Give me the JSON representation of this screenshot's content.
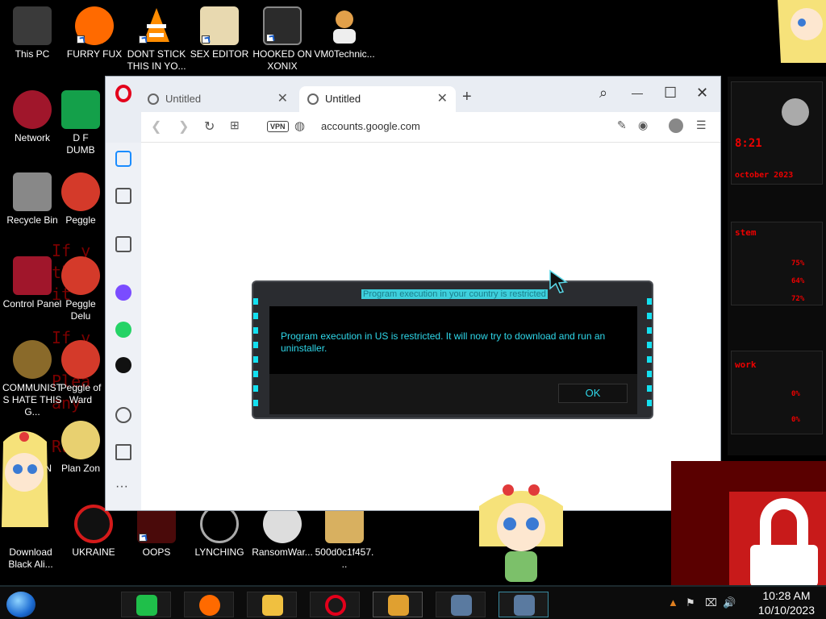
{
  "desktop": {
    "icons_top": [
      {
        "label": "This PC",
        "color": "#3a3a3a"
      },
      {
        "label": "FURRY FUX",
        "color": "#ff6a00"
      },
      {
        "label": "DONT STICK THIS IN YO...",
        "color": "#ff8c00"
      },
      {
        "label": "SEX EDITOR",
        "color": "#c8a24a"
      },
      {
        "label": "HOOKED ON XONIX",
        "color": "#2b2b2b"
      },
      {
        "label": "VM0Technic...",
        "color": "#e2a04a"
      }
    ],
    "icons_left": [
      {
        "label": "Network",
        "color": "#a0162b"
      },
      {
        "label": "Recycle Bin",
        "color": "#888888"
      },
      {
        "label": "Control Panel",
        "color": "#a0162b"
      },
      {
        "label": "COMMUNISTS HATE THIS G...",
        "color": "#8a6a2a"
      }
    ],
    "icons_col2": [
      {
        "label": "D F DUMB",
        "color": "#14a04a"
      },
      {
        "label": "Peggle",
        "color": "#d43a2a"
      },
      {
        "label": "Peggle Delu",
        "color": "#d43a2a"
      },
      {
        "label": "Peggle of Ward",
        "color": "#d43a2a"
      },
      {
        "label": "Plan Zon",
        "color": "#e8d070"
      }
    ],
    "icons_bottom": [
      {
        "label": "Download Black Ali...",
        "color": "#b81a2a"
      },
      {
        "label": "UKRAINE",
        "color": "#d41a1a"
      },
      {
        "label": "OOPS",
        "color": "#4a0a0a"
      },
      {
        "label": "LYNCHING",
        "color": "#aaaaaa"
      },
      {
        "label": "RansomWar...",
        "color": "#dddddd"
      },
      {
        "label": "500d0c1f457...",
        "color": "#d8b060"
      }
    ],
    "bg_text": [
      "If y",
      "th",
      "it",
      "If y",
      "Plea",
      "any",
      "Run"
    ],
    "left_partial_label": "IN"
  },
  "rog_widget": {
    "time": "8:21",
    "date": "october 2023",
    "system_label": "stem",
    "stats": [
      "75%",
      "64%",
      "72%"
    ],
    "network_label": "work",
    "net_stats": [
      "0%",
      "0%"
    ]
  },
  "browser": {
    "tabs": [
      {
        "label": "Untitled",
        "active": false
      },
      {
        "label": "Untitled",
        "active": true
      }
    ],
    "new_tab": "+",
    "window_controls": {
      "search": "⌕",
      "minimize": "—",
      "maximize": "☐",
      "close": "✕"
    },
    "vpn_label": "VPN",
    "url": "accounts.google.com",
    "sidebar_more": "···"
  },
  "dialog": {
    "title": "Program execution in your country is restricted",
    "message": "Program execution in US is restricted. It will now try to download and run an uninstaller.",
    "ok_label": "OK"
  },
  "taskbar": {
    "clock_time": "10:28 AM",
    "clock_date": "10/10/2023",
    "apps": [
      {
        "name": "notes",
        "color": "#1fbf4a"
      },
      {
        "name": "firefox",
        "color": "#ff6a00"
      },
      {
        "name": "explorer",
        "color": "#f0c040"
      },
      {
        "name": "opera",
        "color": "#e3001b"
      },
      {
        "name": "handshake",
        "color": "#e0a030"
      },
      {
        "name": "window1",
        "color": "#5a7aa0"
      },
      {
        "name": "window2",
        "color": "#5a7aa0"
      }
    ]
  }
}
